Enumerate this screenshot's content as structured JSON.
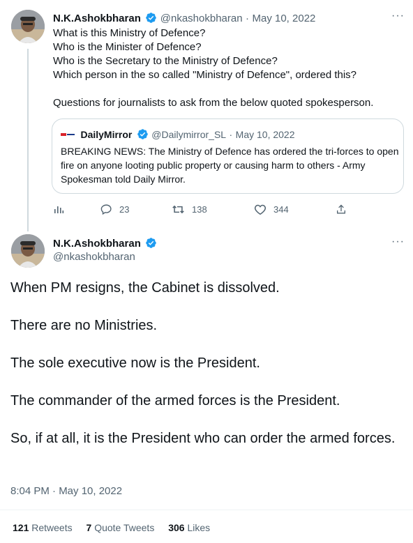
{
  "tweet1": {
    "author_name": "N.K.Ashokbharan",
    "handle": "@nkashokbharan",
    "separator": "·",
    "date": "May 10, 2022",
    "lines": [
      "What is this Ministry of Defence?",
      "Who is the Minister of Defence?",
      "Who is the Secretary to the Ministry of Defence?",
      "Which person in the so called \"Ministry of Defence\", ordered this?",
      "Questions for journalists to ask from the below quoted spokesperson."
    ],
    "quote": {
      "author_name": "DailyMirror",
      "handle": "@Dailymirror_SL",
      "separator": "·",
      "date": "May 10, 2022",
      "text": "BREAKING NEWS: The Ministry of Defence has ordered the tri-forces to open fire on anyone looting public property or causing harm to others - Army Spokesman told Daily Mirror."
    },
    "actions": {
      "replies": "23",
      "retweets": "138",
      "likes": "344"
    }
  },
  "tweet2": {
    "author_name": "N.K.Ashokbharan",
    "handle": "@nkashokbharan",
    "paragraphs": [
      "When PM resigns, the Cabinet is dissolved.",
      "There are no Ministries.",
      "The sole executive now is the President.",
      "The commander of the armed forces is the President.",
      "So, if at all, it is the President who can order the armed forces."
    ],
    "timestamp": "8:04 PM · May 10, 2022",
    "stats": {
      "retweets_count": "121",
      "retweets_label": "Retweets",
      "quotes_count": "7",
      "quotes_label": "Quote Tweets",
      "likes_count": "306",
      "likes_label": "Likes"
    }
  },
  "more_glyph": "···",
  "colors": {
    "text": "#0f1419",
    "muted": "#536471",
    "verified": "#1d9bf0",
    "border": "#cfd9de"
  }
}
